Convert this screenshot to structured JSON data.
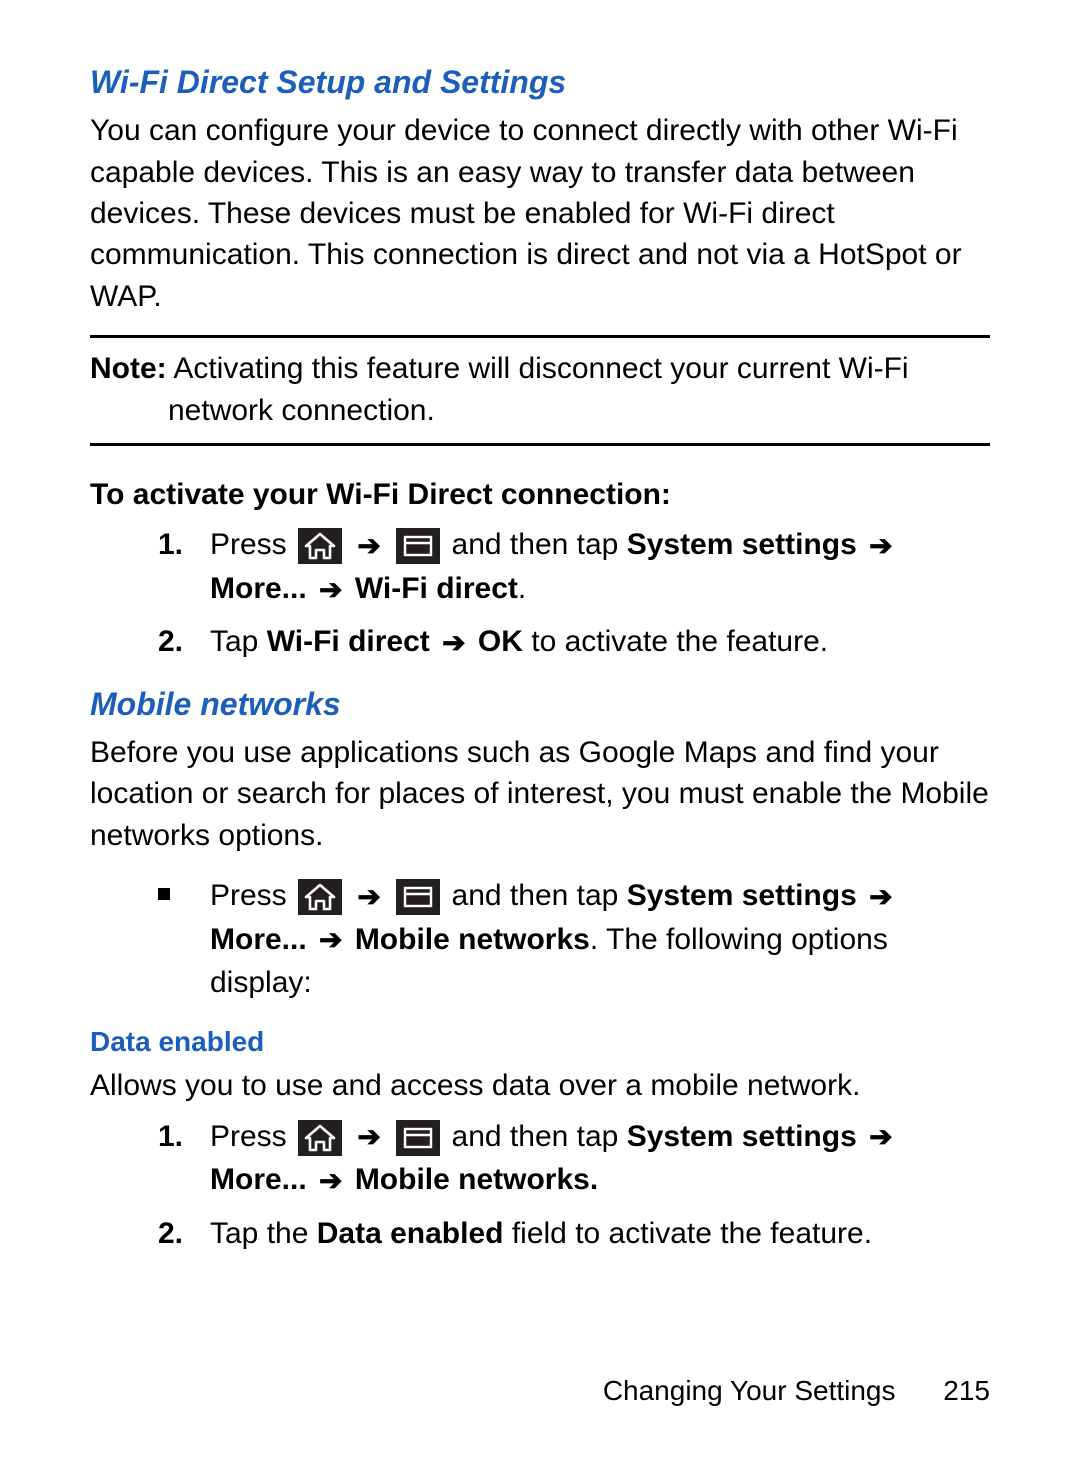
{
  "section1": {
    "title": "Wi-Fi Direct Setup and Settings",
    "body": "You can configure your device to connect directly with other Wi-Fi capable devices. This is an easy way to transfer data between devices. These devices must be enabled for Wi-Fi direct communication. This connection is direct and not via a HotSpot or WAP.",
    "note_label": "Note:",
    "note_text": " Activating this feature will disconnect your current Wi-Fi network connection.",
    "subhead": "To activate your Wi-Fi Direct connection:",
    "step1_a": "Press ",
    "step1_b": " and then tap ",
    "step1_c": "System settings ",
    "step1_d": " More... ",
    "step1_e": " Wi-Fi direct",
    "step1_f": ".",
    "step2_a": "Tap ",
    "step2_b": "Wi-Fi direct ",
    "step2_c": " OK",
    "step2_d": " to activate the feature."
  },
  "section2": {
    "title": "Mobile networks",
    "body": "Before you use applications such as Google Maps and find your location or search for places of interest, you must enable the Mobile networks options.",
    "b1_a": "Press ",
    "b1_b": " and then tap ",
    "b1_c": "System settings ",
    "b1_d": " More... ",
    "b1_e": " Mobile networks",
    "b1_f": ". The following options display:"
  },
  "section3": {
    "title": "Data enabled",
    "body": "Allows you to use and access data over a mobile network.",
    "step1_a": "Press ",
    "step1_b": " and then tap ",
    "step1_c": "System settings ",
    "step1_d": " More... ",
    "step1_e": " Mobile networks.",
    "step2_a": " Tap the ",
    "step2_b": "Data enabled",
    "step2_c": " field to activate the feature."
  },
  "arrow": "➔",
  "footer": {
    "chapter": "Changing Your Settings",
    "page": "215"
  }
}
